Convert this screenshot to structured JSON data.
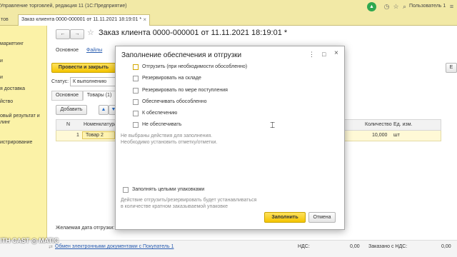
{
  "app": {
    "title": "Управление торговлей, редакция 11  (1С:Предприятие)",
    "user": "Пользователь 1",
    "icons": [
      "bell-icon",
      "history-icon",
      "star-icon",
      "search-icon",
      "user-icon",
      "menu-icon",
      "minimize-icon",
      "maximize-icon",
      "close-icon"
    ]
  },
  "tabs": {
    "left_stub": "тов",
    "active": "Заказ клиента 0000-000001 от 11.11.2021 18:19:01 *",
    "close": "×"
  },
  "sidebar": {
    "items": [
      "маркетинг",
      "и",
      "и",
      "я доставка",
      "йство",
      "овый результат и",
      "линг",
      "истрирование"
    ]
  },
  "document": {
    "back": "←",
    "forward": "→",
    "star": "☆",
    "title": "Заказ клиента 0000-000001 от 11.11.2021 18:19:01 *",
    "nav_main": "Основное",
    "nav_files": "Файлы",
    "post_close": "Провести и закрыть",
    "status_label": "Статус:",
    "status_value": "К выполнению",
    "more_right": "Е",
    "subtabs": [
      "Основное",
      "Товары (1)"
    ],
    "add": "Добавить",
    "up": "▲",
    "down": "▼",
    "table": {
      "headers": [
        "N",
        "Номенклатура",
        "Количество",
        "Ед. изм."
      ],
      "row": {
        "n": "1",
        "item": "Товар 2",
        "qty": "10,000",
        "unit": "шт"
      }
    },
    "desired_date_label": "Желаемая дата отгрузки:",
    "link": "Обмен электронными документами с Покупатель 1",
    "vat_label1": "НДС:",
    "vat_value1": "0,00",
    "ordered_vat_label": "Заказано с НДС:",
    "ordered_vat_value": "0,00"
  },
  "modal": {
    "title": "Заполнение обеспечения и отгрузки",
    "controls": {
      "more": "⋮",
      "maximize": "□",
      "close": "×"
    },
    "options": [
      "Отгрузить (при необходимости обособленно)",
      "Резервировать на складе",
      "Резервировать по мере поступления",
      "Обеспечивать обособленно",
      "К обеспечению",
      "Не обеспечивать"
    ],
    "hint1": "Не выбраны действия для заполнения.",
    "hint2": "Необходимо установить отметку/отметки.",
    "packages_checkbox": "Заполнять целыми упаковками",
    "packages_hint1": "Действие отгрузить/резервировать будет устанавливаться",
    "packages_hint2": "в количестве кратном заказываемой упаковке",
    "fill_button": "Заполнить",
    "cancel_button": "Отмена"
  },
  "watermark": "ITH  CAST ◎ MATIC",
  "colors": {
    "header_bg": "#f2e9a6",
    "sidebar_bg": "#fbf2a7",
    "accent_yellow": "#f4c400",
    "link": "#2a5db0",
    "user_green": "#2fa84f"
  }
}
